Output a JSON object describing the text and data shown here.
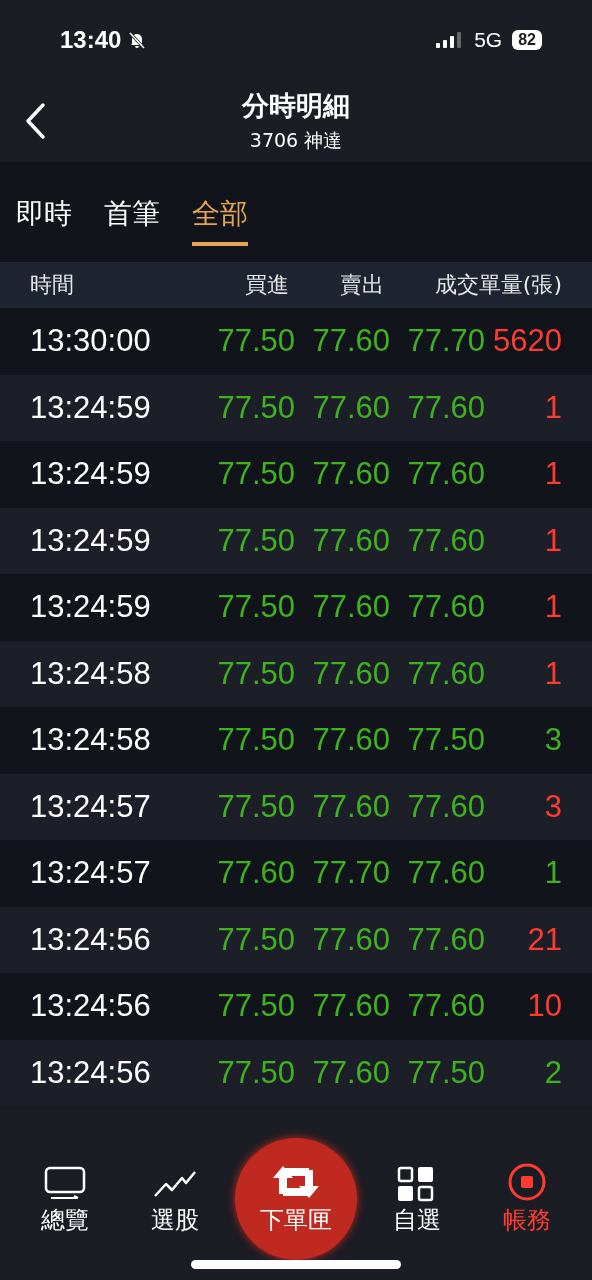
{
  "status_bar": {
    "time": "13:40",
    "network": "5G",
    "battery": "82"
  },
  "header": {
    "title": "分時明細",
    "subtitle": "3706 神達"
  },
  "tabs": [
    {
      "label": "即時",
      "selected": false
    },
    {
      "label": "首筆",
      "selected": false
    },
    {
      "label": "全部",
      "selected": true
    }
  ],
  "table": {
    "columns": [
      "時間",
      "買進",
      "賣出",
      "成交單量(張)"
    ],
    "rows": [
      {
        "time": "13:30:00",
        "bid": "77.50",
        "ask": "77.60",
        "price": "77.70",
        "volume": "5620",
        "color": "#ff3b30"
      },
      {
        "time": "13:24:59",
        "bid": "77.50",
        "ask": "77.60",
        "price": "77.60",
        "volume": "1",
        "color": "#ff3b30"
      },
      {
        "time": "13:24:59",
        "bid": "77.50",
        "ask": "77.60",
        "price": "77.60",
        "volume": "1",
        "color": "#ff3b30"
      },
      {
        "time": "13:24:59",
        "bid": "77.50",
        "ask": "77.60",
        "price": "77.60",
        "volume": "1",
        "color": "#ff3b30"
      },
      {
        "time": "13:24:59",
        "bid": "77.50",
        "ask": "77.60",
        "price": "77.60",
        "volume": "1",
        "color": "#ff3b30"
      },
      {
        "time": "13:24:58",
        "bid": "77.50",
        "ask": "77.60",
        "price": "77.60",
        "volume": "1",
        "color": "#ff3b30"
      },
      {
        "time": "13:24:58",
        "bid": "77.50",
        "ask": "77.60",
        "price": "77.50",
        "volume": "3",
        "color": "#3fb21f"
      },
      {
        "time": "13:24:57",
        "bid": "77.50",
        "ask": "77.60",
        "price": "77.60",
        "volume": "3",
        "color": "#ff3b30"
      },
      {
        "time": "13:24:57",
        "bid": "77.60",
        "ask": "77.70",
        "price": "77.60",
        "volume": "1",
        "color": "#3fb21f"
      },
      {
        "time": "13:24:56",
        "bid": "77.50",
        "ask": "77.60",
        "price": "77.60",
        "volume": "21",
        "color": "#ff3b30"
      },
      {
        "time": "13:24:56",
        "bid": "77.50",
        "ask": "77.60",
        "price": "77.60",
        "volume": "10",
        "color": "#ff3b30"
      },
      {
        "time": "13:24:56",
        "bid": "77.50",
        "ask": "77.60",
        "price": "77.50",
        "volume": "2",
        "color": "#3fb21f"
      }
    ]
  },
  "nav": [
    {
      "label": "總覽",
      "kind": "overview",
      "selected": false
    },
    {
      "label": "選股",
      "kind": "picker",
      "selected": false
    },
    {
      "label": "下單匣",
      "kind": "order",
      "selected": false
    },
    {
      "label": "自選",
      "kind": "watchlist",
      "selected": false
    },
    {
      "label": "帳務",
      "kind": "account",
      "selected": true
    }
  ]
}
